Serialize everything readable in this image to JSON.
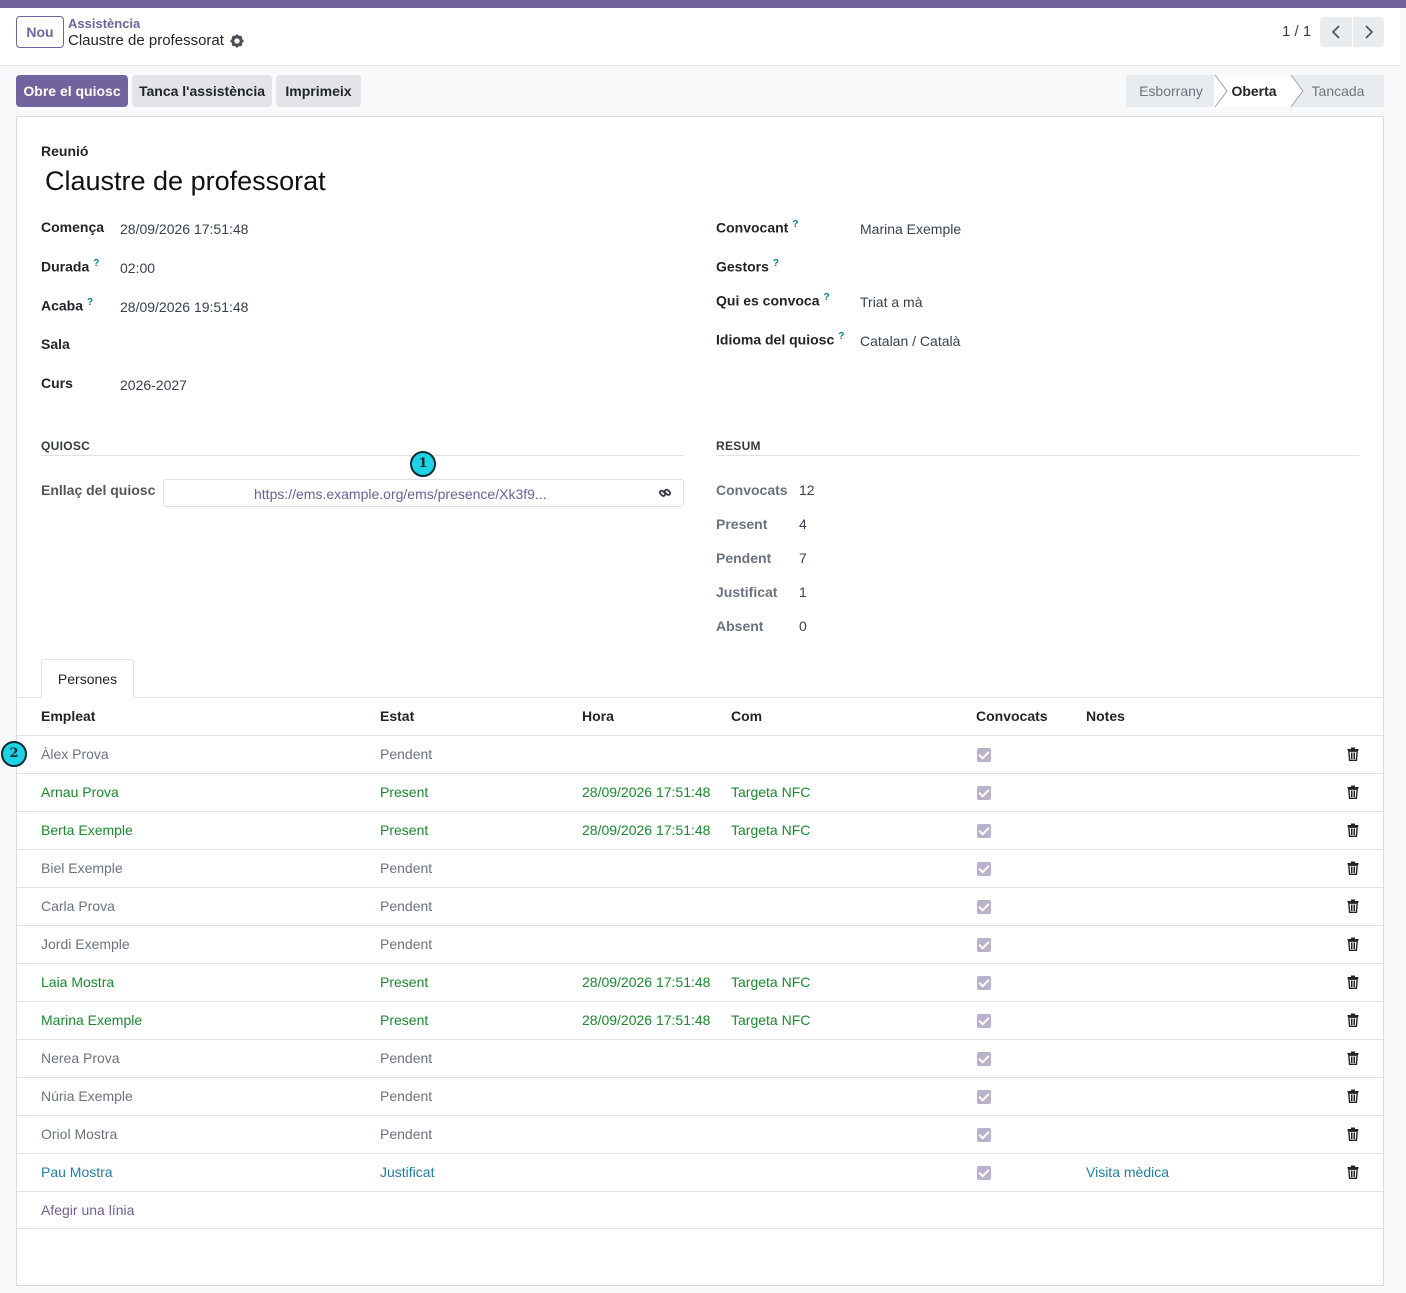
{
  "header": {
    "new_label": "Nou",
    "breadcrumb": "Assistència",
    "record_title": "Claustre de professorat",
    "pager": "1 / 1"
  },
  "actions": {
    "open_kiosk": "Obre el quiosc",
    "close_attendance": "Tanca l'assistència",
    "print": "Imprimeix"
  },
  "statusbar": {
    "stages": [
      "Esborrany",
      "Oberta",
      "Tancada"
    ],
    "active": "Oberta"
  },
  "form": {
    "meeting_label": "Reunió",
    "meeting_name": "Claustre de professorat",
    "starts_label": "Comença",
    "starts_value": "28/09/2026 17:51:48",
    "duration_label": "Durada",
    "duration_value": "02:00",
    "ends_label": "Acaba",
    "ends_value": "28/09/2026 19:51:48",
    "room_label": "Sala",
    "room_value": "",
    "course_label": "Curs",
    "course_value": "2026-2027",
    "convener_label": "Convocant",
    "convener_value": "Marina Exemple",
    "managers_label": "Gestors",
    "managers_value": "",
    "who_label": "Qui es convoca",
    "who_value": "Triat a mà",
    "lang_label": "Idioma del quiosc",
    "lang_value": "Catalan / Català",
    "help_mark": "?"
  },
  "kiosk": {
    "section_title": "QUIOSC",
    "link_label": "Enllaç del quiosc",
    "link_value": "https://ems.example.org/ems/presence/Xk3f9..."
  },
  "summary": {
    "section_title": "RESUM",
    "items": [
      {
        "label": "Convocats",
        "value": "12"
      },
      {
        "label": "Present",
        "value": "4"
      },
      {
        "label": "Pendent",
        "value": "7"
      },
      {
        "label": "Justificat",
        "value": "1"
      },
      {
        "label": "Absent",
        "value": "0"
      }
    ]
  },
  "tabs": [
    "Persones"
  ],
  "table": {
    "columns": [
      "Empleat",
      "Estat",
      "Hora",
      "Com",
      "Convocats",
      "Notes"
    ],
    "rows": [
      {
        "name": "Àlex Prova",
        "state": "Pendent",
        "time": "",
        "how": "",
        "notes": ""
      },
      {
        "name": "Arnau Prova",
        "state": "Present",
        "time": "28/09/2026 17:51:48",
        "how": "Targeta NFC",
        "notes": ""
      },
      {
        "name": "Berta Exemple",
        "state": "Present",
        "time": "28/09/2026 17:51:48",
        "how": "Targeta NFC",
        "notes": ""
      },
      {
        "name": "Biel Exemple",
        "state": "Pendent",
        "time": "",
        "how": "",
        "notes": ""
      },
      {
        "name": "Carla Prova",
        "state": "Pendent",
        "time": "",
        "how": "",
        "notes": ""
      },
      {
        "name": "Jordi Exemple",
        "state": "Pendent",
        "time": "",
        "how": "",
        "notes": ""
      },
      {
        "name": "Laia Mostra",
        "state": "Present",
        "time": "28/09/2026 17:51:48",
        "how": "Targeta NFC",
        "notes": ""
      },
      {
        "name": "Marina Exemple",
        "state": "Present",
        "time": "28/09/2026 17:51:48",
        "how": "Targeta NFC",
        "notes": ""
      },
      {
        "name": "Nerea Prova",
        "state": "Pendent",
        "time": "",
        "how": "",
        "notes": ""
      },
      {
        "name": "Núria Exemple",
        "state": "Pendent",
        "time": "",
        "how": "",
        "notes": ""
      },
      {
        "name": "Oriol Mostra",
        "state": "Pendent",
        "time": "",
        "how": "",
        "notes": ""
      },
      {
        "name": "Pau Mostra",
        "state": "Justificat",
        "time": "",
        "how": "",
        "notes": "Visita mèdica"
      }
    ],
    "add_line": "Afegir una línia"
  },
  "markers": [
    "1",
    "2"
  ],
  "colors": {
    "brand": "#71639e",
    "present": "#198a2d",
    "pending": "#6b7280",
    "justified": "#1d7ea5"
  }
}
